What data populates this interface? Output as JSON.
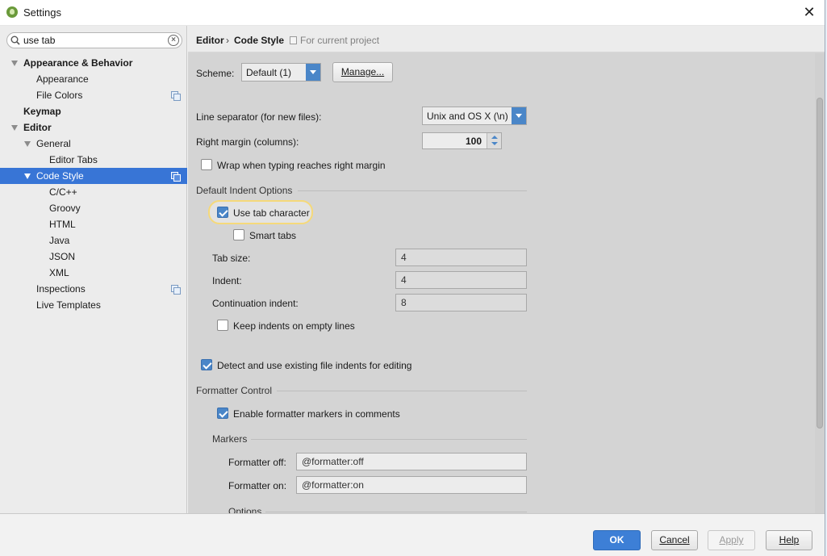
{
  "window": {
    "title": "Settings"
  },
  "search": {
    "value": "use tab",
    "placeholder": ""
  },
  "tree": [
    {
      "label": "Appearance & Behavior"
    },
    {
      "label": "Appearance"
    },
    {
      "label": "File Colors"
    },
    {
      "label": "Keymap"
    },
    {
      "label": "Editor"
    },
    {
      "label": "General"
    },
    {
      "label": "Editor Tabs"
    },
    {
      "label": "Code Style"
    },
    {
      "label": "C/C++"
    },
    {
      "label": "Groovy"
    },
    {
      "label": "HTML"
    },
    {
      "label": "Java"
    },
    {
      "label": "JSON"
    },
    {
      "label": "XML"
    },
    {
      "label": "Inspections"
    },
    {
      "label": "Live Templates"
    }
  ],
  "breadcrumb": {
    "parent": "Editor",
    "separator": "›",
    "current": "Code Style",
    "note": "For current project"
  },
  "scheme": {
    "label": "Scheme:",
    "value": "Default (1)",
    "manage_label": "Manage..."
  },
  "line_separator": {
    "label": "Line separator (for new files):",
    "value": "Unix and OS X (\\n)"
  },
  "right_margin": {
    "label": "Right margin (columns):",
    "value": "100"
  },
  "wrap_typing": {
    "label": "Wrap when typing reaches right margin",
    "checked": false
  },
  "indent_section": {
    "title": "Default Indent Options"
  },
  "use_tab": {
    "label": "Use tab character",
    "checked": true
  },
  "smart_tabs": {
    "label": "Smart tabs",
    "checked": false
  },
  "tab_size": {
    "label": "Tab size:",
    "value": "4"
  },
  "indent": {
    "label": "Indent:",
    "value": "4"
  },
  "continuation_indent": {
    "label": "Continuation indent:",
    "value": "8"
  },
  "keep_indents": {
    "label": "Keep indents on empty lines",
    "checked": false
  },
  "detect_indents": {
    "label": "Detect and use existing file indents for editing",
    "checked": true
  },
  "formatter_section": {
    "title": "Formatter Control"
  },
  "formatter_markers": {
    "label": "Enable formatter markers in comments",
    "checked": true
  },
  "markers_section": {
    "title": "Markers"
  },
  "formatter_off": {
    "label": "Formatter off:",
    "value": "@formatter:off"
  },
  "formatter_on": {
    "label": "Formatter on:",
    "value": "@formatter:on"
  },
  "options_section": {
    "title": "Options"
  },
  "buttons": {
    "ok": "OK",
    "cancel": "Cancel",
    "apply": "Apply",
    "help": "Help"
  },
  "colors": {
    "accent": "#3875d6",
    "ok_button": "#3d7fd6",
    "highlight": "#f5d97a"
  }
}
